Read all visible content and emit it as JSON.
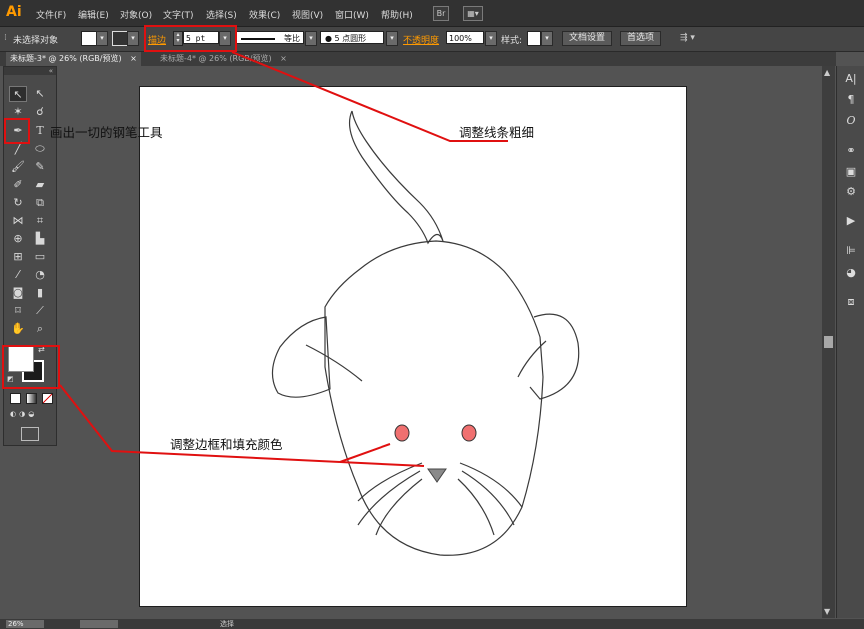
{
  "app": {
    "logo": "Ai"
  },
  "menu": [
    "文件(F)",
    "编辑(E)",
    "对象(O)",
    "文字(T)",
    "选择(S)",
    "效果(C)",
    "视图(V)",
    "窗口(W)",
    "帮助(H)"
  ],
  "control_bar": {
    "selection": "未选择对象",
    "stroke_label": "描边",
    "stroke_weight": "5 pt",
    "profile_label": "等比",
    "brush_label": "5 点圆形",
    "opacity_label": "不透明度",
    "opacity_value": "100%",
    "style_label": "样式:",
    "doc_setup": "文档设置",
    "preferences": "首选项"
  },
  "tabs": [
    {
      "label": "未标题-3* @ 26% (RGB/预览)",
      "close": "×"
    },
    {
      "label": "未标题-4* @ 26% (RGB/预览)",
      "close": "×"
    }
  ],
  "toolbox_header": "«",
  "annotations": {
    "pen_tool": "画出一切的钢笔工具",
    "stroke_weight": "调整线条粗细",
    "colors": "调整边框和填充颜色"
  },
  "status": {
    "zoom": "26%",
    "mode": "选择"
  },
  "colors": {
    "highlight": "#e01010",
    "mouse_eye": "#f07070",
    "mouse_nose": "#8a8a8a",
    "accent": "#ff9a00"
  }
}
